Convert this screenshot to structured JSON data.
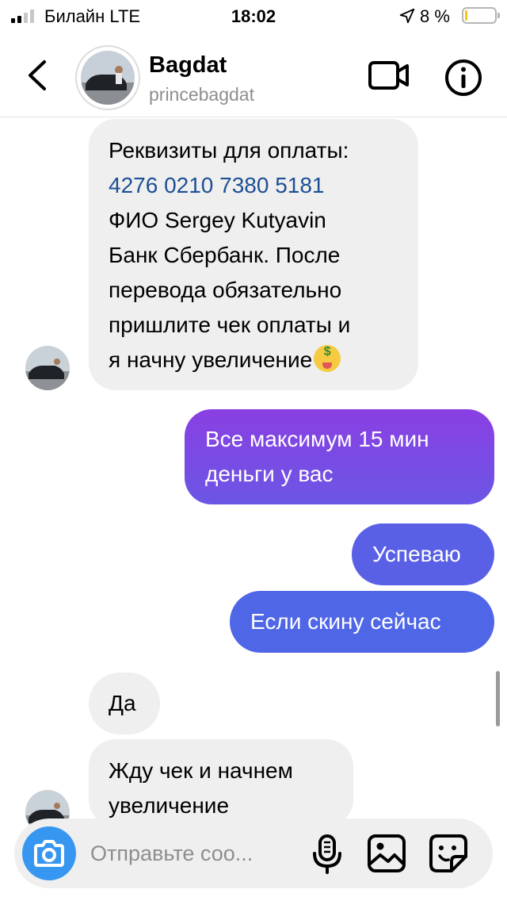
{
  "status_bar": {
    "carrier": "Билайн  LTE",
    "time": "18:02",
    "battery_percent": "8 %",
    "battery_level": 0.08,
    "icons": [
      "signal-icon",
      "location-arrow-icon",
      "battery-icon"
    ]
  },
  "header": {
    "name": "Bagdat",
    "username": "princebagdat",
    "icons": [
      "back-chevron-icon",
      "video-call-icon",
      "info-icon"
    ]
  },
  "messages": [
    {
      "direction": "incoming",
      "lines": [
        "Реквизиты для оплаты:",
        "4276 0210 7380 5181",
        "ФИО Sergey Kutyavin",
        "Банк Сбербанк. После",
        "перевода обязательно",
        "пришлите чек оплаты и",
        "я начну увеличение"
      ],
      "emoji": "money-mouth-face-icon"
    },
    {
      "direction": "outgoing",
      "lines": [
        "Все максимум 15 мин",
        "деньги у вас"
      ]
    },
    {
      "direction": "outgoing",
      "lines": [
        "Успеваю"
      ]
    },
    {
      "direction": "outgoing",
      "lines": [
        "Если скину сейчас"
      ]
    },
    {
      "direction": "incoming",
      "lines": [
        "Да"
      ]
    },
    {
      "direction": "incoming",
      "lines": [
        "Жду чек и начнем",
        "увеличение"
      ]
    }
  ],
  "composer": {
    "placeholder": "Отправьте соо...",
    "icons": [
      "camera-icon",
      "microphone-icon",
      "gallery-icon",
      "sticker-icon"
    ]
  },
  "colors": {
    "incoming_bubble": "#efefef",
    "outgoing_gradient": [
      "#8a3fe3",
      "#4b6ae6"
    ],
    "link_blue": "#1d4f95",
    "camera_blue": "#3797f0"
  }
}
